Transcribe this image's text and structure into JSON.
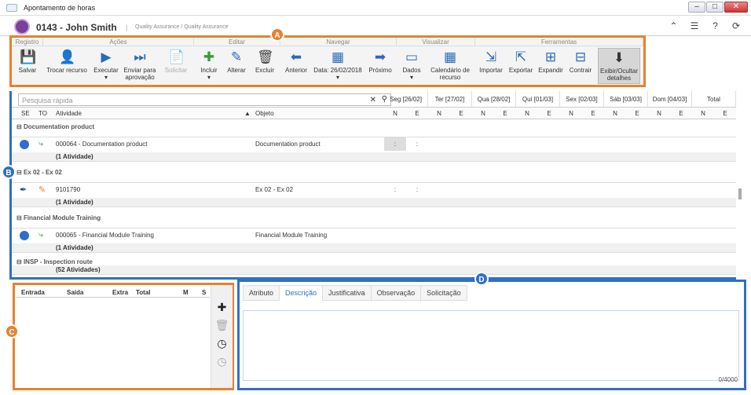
{
  "window": {
    "title": "Apontamento de horas"
  },
  "header": {
    "employee": "0143 - John Smith",
    "role": "Quality Assurance / Quality Assurance"
  },
  "badges": [
    "A",
    "B",
    "C",
    "D"
  ],
  "toolbar": {
    "groups": [
      "Registro",
      "Ações",
      "Editar",
      "Navegar",
      "Visualizar",
      "Ferramentas"
    ],
    "salvar": "Salvar",
    "trocar": "Trocar recurso",
    "executar": "Executar",
    "enviar": "Enviar para aprovação",
    "solicitar": "Solicitar",
    "incluir": "Incluir",
    "alterar": "Alterar",
    "excluir": "Excluir",
    "anterior": "Anterior",
    "data": "Data: 26/02/2018",
    "proximo": "Próximo",
    "dados": "Dados",
    "calendario": "Calendário de recurso",
    "importar": "Importar",
    "exportar": "Exportar",
    "expandir": "Expandir",
    "contrair": "Contrair",
    "exibir": "Exibir/Ocultar detalhes"
  },
  "grid": {
    "search_placeholder": "Pesquisa rápida",
    "days": [
      "Seg [26/02]",
      "Ter [27/02]",
      "Qua [28/02]",
      "Qui [01/03]",
      "Sex [02/03]",
      "Sáb [03/03]",
      "Dom [04/03]",
      "Total"
    ],
    "col_se": "SE",
    "col_to": "TO",
    "col_atividade": "Atividade",
    "col_objeto": "Objeto",
    "col_n": "N",
    "col_e": "E",
    "groups": [
      {
        "name": "Documentation product",
        "activity": "000064 - Documentation product",
        "object": "Documentation product",
        "count": "(1 Atividade)"
      },
      {
        "name": "Ex 02 - Ex 02",
        "activity": "9101790",
        "object": "Ex 02 - Ex 02",
        "count": "(1 Atividade)"
      },
      {
        "name": "Financial Module Training",
        "activity": "000065 - Financial Module Training",
        "object": "Financial Module Training",
        "count": "(1 Atividade)"
      },
      {
        "name": "INSP - Inspection route",
        "count": "(52 Atividades)"
      }
    ],
    "colon": ":"
  },
  "hours": {
    "entrada": "Entrada",
    "saida": "Saída",
    "extra": "Extra",
    "total": "Total",
    "m": "M",
    "s": "S"
  },
  "details": {
    "tabs": [
      "Atributo",
      "Descrição",
      "Justificativa",
      "Observação",
      "Solicitação"
    ],
    "counter": "0/4000"
  }
}
